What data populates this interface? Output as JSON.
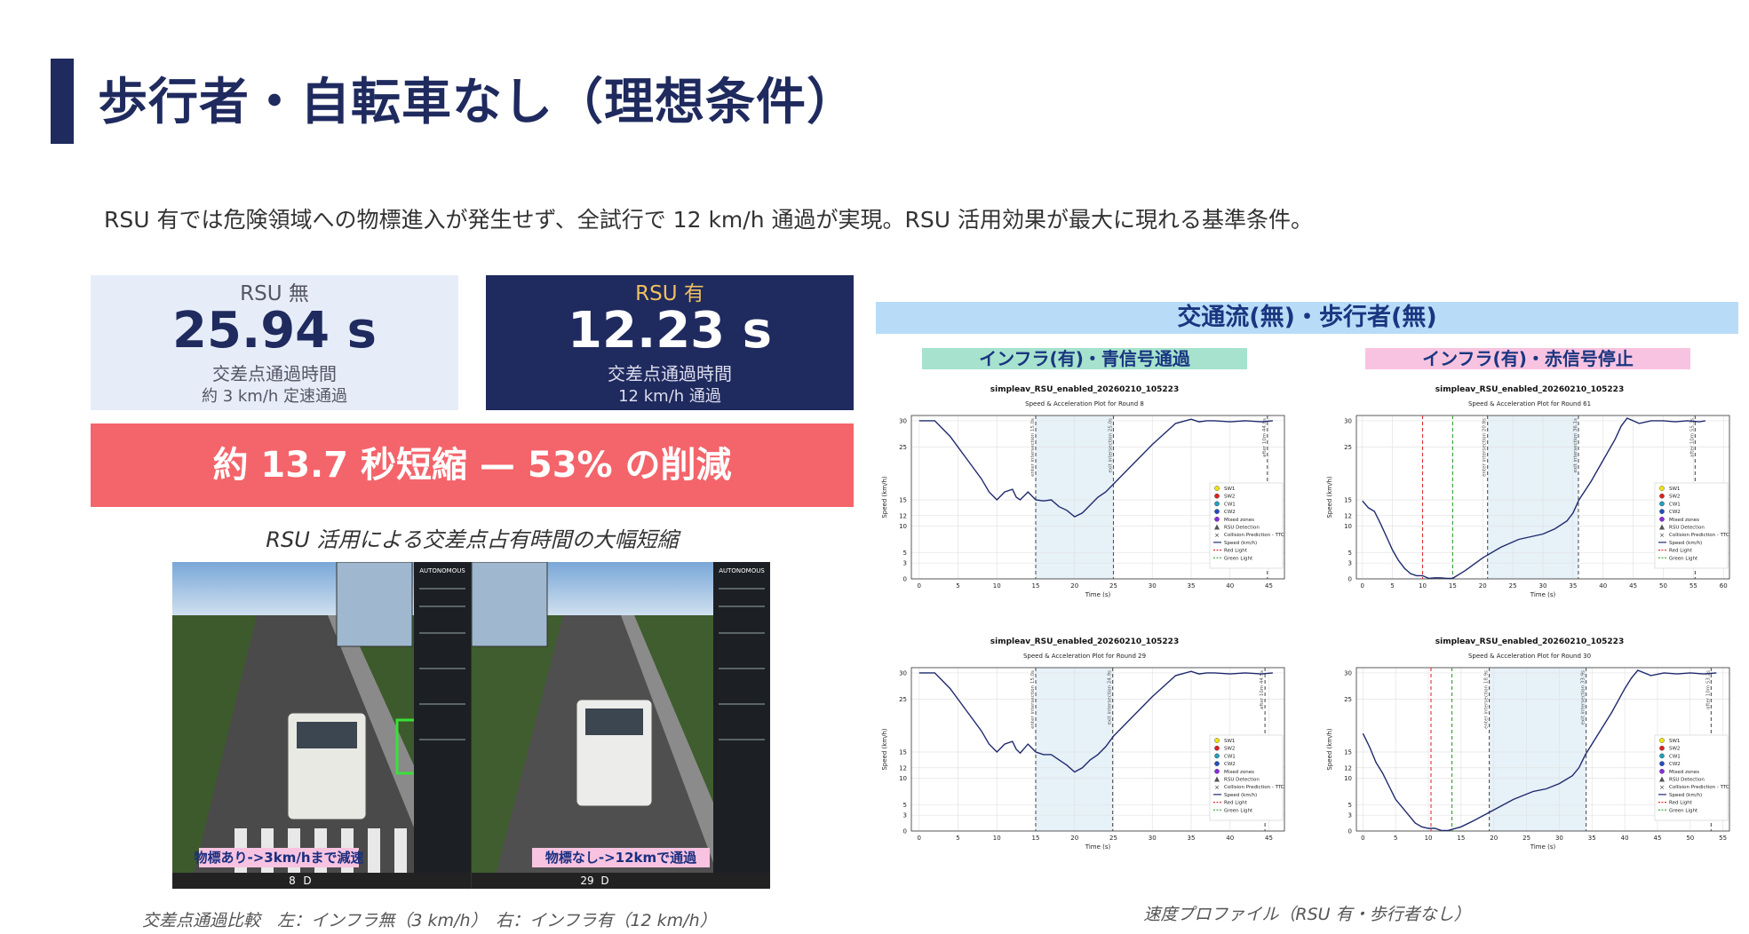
{
  "header": {
    "title": "歩行者・自転車なし（理想条件）",
    "subtitle": "RSU 有では危険領域への物標進入が発生せず、全試行で 12 km/h 通過が実現。RSU 活用効果が最大に現れる基準条件。"
  },
  "cards": {
    "off": {
      "label": "RSU 無",
      "value": "25.94 s",
      "desc": "交差点通過時間",
      "note": "約 3 km/h 定速通過"
    },
    "on": {
      "label": "RSU 有",
      "value": "12.23 s",
      "desc": "交差点通過時間",
      "note": "12 km/h 通過"
    }
  },
  "banner": "約 13.7 秒短縮 — 53% の削減",
  "comparison_caption": "RSU 活用による交差点占有時間の大幅短縮",
  "screenshot": {
    "left_overlay": "物標あり->3km/hまで減速",
    "right_overlay": "物標なし->12kmで通過",
    "panel_title": "AUTONOMOUS",
    "left_speed": "8",
    "left_gear": "D",
    "right_speed": "29",
    "right_gear": "D",
    "caption": "交差点通過比較　左：インフラ無（3 km/h）　右：インフラ有（12 km/h）"
  },
  "charts_header": "交通流(無)・歩行者(無)",
  "chart_col_labels": [
    "インフラ(有)・青信号通過",
    "インフラ(有)・赤信号停止"
  ],
  "profile_caption": "速度プロファイル（RSU 有・歩行者なし）",
  "legend_items": [
    "SW1",
    "SW2",
    "CW1",
    "CW2",
    "Mixed zones",
    "RSU Detection",
    "Collision Prediction - TTC",
    "Speed (km/h)",
    "Red Light",
    "Green Light"
  ],
  "legend_colors": [
    "#f2e600",
    "#e02020",
    "#20a0c0",
    "#2050c0",
    "#8a2be2",
    "#555555",
    "#333333",
    "#1f2a6e",
    "#e03030",
    "#30a030"
  ],
  "chart_data": [
    {
      "type": "line",
      "title": "simpleav_RSU_enabled_20260210_105223",
      "subtitle": "Speed & Acceleration Plot for Round 8",
      "xlabel": "Time (s)",
      "ylabel": "Speed (km/h)",
      "xlim": [
        -1,
        47
      ],
      "xticks": [
        0,
        5,
        10,
        15,
        20,
        25,
        30,
        35,
        40,
        45
      ],
      "ylim": [
        0,
        31
      ],
      "yticks": [
        0,
        3,
        5,
        10,
        12,
        15,
        25,
        30
      ],
      "grid": true,
      "legend": "right",
      "shade": [
        15,
        25
      ],
      "vlines": [
        {
          "x": 15,
          "color": "#555",
          "label": "enter intersection 15.0s"
        },
        {
          "x": 25,
          "color": "#555",
          "label": "exit intersection 25.0s"
        },
        {
          "x": 44.8,
          "color": "#555",
          "label": "after 10m 44.8s"
        }
      ],
      "series": [
        {
          "x": [
            0,
            2,
            4,
            6,
            8,
            9,
            10,
            11,
            12,
            12.5,
            13,
            14,
            15,
            16,
            17,
            18,
            19,
            20,
            21,
            22,
            23,
            24,
            25,
            27,
            30,
            33,
            35,
            36,
            37,
            38,
            40,
            42,
            44,
            45.5
          ],
          "y": [
            30,
            30,
            27,
            23,
            19,
            16.5,
            15,
            16.5,
            17,
            15.5,
            15,
            16.5,
            15,
            14.8,
            15,
            13.7,
            13,
            11.8,
            12.5,
            14,
            15.5,
            16.5,
            18,
            21,
            25.5,
            29.5,
            30.3,
            29.8,
            30,
            30,
            29.8,
            30,
            29.8,
            30
          ]
        }
      ]
    },
    {
      "type": "line",
      "title": "simpleav_RSU_enabled_20260210_105223",
      "subtitle": "Speed & Acceleration Plot for Round 61",
      "xlabel": "Time (s)",
      "ylabel": "Speed (km/h)",
      "xlim": [
        -1,
        61
      ],
      "xticks": [
        0,
        5,
        10,
        15,
        20,
        25,
        30,
        35,
        40,
        45,
        50,
        55,
        60
      ],
      "ylim": [
        0,
        31
      ],
      "yticks": [
        0,
        3,
        5,
        10,
        12,
        15,
        25,
        30
      ],
      "grid": true,
      "legend": "right",
      "shade": [
        20.8,
        35.9
      ],
      "vlines": [
        {
          "x": 10,
          "color": "#e03030",
          "label": ""
        },
        {
          "x": 15,
          "color": "#30a030",
          "label": ""
        },
        {
          "x": 20.8,
          "color": "#555",
          "label": "enter intersection 20.8s"
        },
        {
          "x": 35.9,
          "color": "#555",
          "label": "exit intersection 36.1s"
        },
        {
          "x": 55.3,
          "color": "#555",
          "label": "after 10m 55.3s"
        }
      ],
      "series": [
        {
          "x": [
            0,
            1,
            2,
            3,
            4,
            5,
            6,
            7,
            8,
            9,
            10,
            11,
            12,
            13,
            14,
            15,
            17,
            20,
            23,
            26,
            28,
            30,
            32,
            34,
            35,
            36,
            38,
            40,
            42,
            43,
            44,
            46,
            48,
            50,
            52,
            54,
            56,
            57
          ],
          "y": [
            14.8,
            13.5,
            12.8,
            10.5,
            8,
            5.5,
            3.5,
            2,
            1,
            0.6,
            0.6,
            0.1,
            0.2,
            0.2,
            0.1,
            0.1,
            1.5,
            4,
            6,
            7.5,
            8,
            8.5,
            9.5,
            11,
            12.5,
            15,
            18.5,
            22.5,
            26.5,
            29,
            30.5,
            29.5,
            30,
            30,
            29.8,
            30,
            29.8,
            30
          ]
        }
      ]
    },
    {
      "type": "line",
      "title": "simpleav_RSU_enabled_20260210_105223",
      "subtitle": "Speed & Acceleration Plot for Round 29",
      "xlabel": "Time (s)",
      "ylabel": "Speed (km/h)",
      "xlim": [
        -1,
        47
      ],
      "xticks": [
        0,
        5,
        10,
        15,
        20,
        25,
        30,
        35,
        40,
        45
      ],
      "ylim": [
        0,
        31
      ],
      "yticks": [
        0,
        3,
        5,
        10,
        12,
        15,
        25,
        30
      ],
      "grid": true,
      "legend": "right",
      "shade": [
        15,
        24.9
      ],
      "vlines": [
        {
          "x": 15,
          "color": "#555",
          "label": "enter intersection 15.0s"
        },
        {
          "x": 24.9,
          "color": "#555",
          "label": "exit intersection 24.9s"
        },
        {
          "x": 44.5,
          "color": "#555",
          "label": "after 10m 44.5s"
        }
      ],
      "series": [
        {
          "x": [
            0,
            2,
            4,
            6,
            8,
            9,
            10,
            11,
            12,
            12.5,
            13,
            14,
            15,
            16,
            17,
            18,
            19,
            20,
            21,
            22,
            23,
            24,
            25,
            27,
            30,
            33,
            35,
            36,
            37,
            38,
            40,
            42,
            44,
            45.5
          ],
          "y": [
            30,
            30,
            27,
            23,
            19,
            16.5,
            15,
            16.5,
            17,
            15.5,
            14.8,
            16.5,
            15,
            14.5,
            14.5,
            13.5,
            12.5,
            11.2,
            12,
            13.5,
            14.5,
            16,
            18,
            21,
            25.5,
            29.5,
            30.3,
            29.8,
            30,
            30,
            29.8,
            30,
            29.8,
            30
          ]
        }
      ]
    },
    {
      "type": "line",
      "title": "simpleav_RSU_enabled_20260210_105223",
      "subtitle": "Speed & Acceleration Plot for Round 30",
      "xlabel": "Time (s)",
      "ylabel": "Speed (km/h)",
      "xlim": [
        -1,
        56
      ],
      "xticks": [
        0,
        5,
        10,
        15,
        20,
        25,
        30,
        35,
        40,
        45,
        50,
        55
      ],
      "ylim": [
        0,
        31
      ],
      "yticks": [
        0,
        3,
        5,
        10,
        12,
        15,
        25,
        30
      ],
      "grid": true,
      "legend": "right",
      "shade": [
        19.3,
        34.1
      ],
      "vlines": [
        {
          "x": 10.4,
          "color": "#e03030",
          "label": ""
        },
        {
          "x": 13.6,
          "color": "#30a030",
          "label": ""
        },
        {
          "x": 19.3,
          "color": "#555",
          "label": "enter intersection 18.9s"
        },
        {
          "x": 34.1,
          "color": "#555",
          "label": "exit intersection 33.9s"
        },
        {
          "x": 53.2,
          "color": "#555",
          "label": "after 10m 53.2s"
        }
      ],
      "series": [
        {
          "x": [
            0,
            1,
            2,
            3,
            4,
            5,
            6,
            7,
            8,
            9,
            10,
            11,
            12,
            13,
            15,
            17,
            20,
            23,
            26,
            28,
            30,
            32,
            33,
            34,
            36,
            38,
            40,
            41,
            42,
            44,
            46,
            48,
            50,
            52,
            54
          ],
          "y": [
            18.5,
            16,
            13,
            11,
            8.5,
            6,
            4.5,
            3,
            1.5,
            0.8,
            0.5,
            0.5,
            0.1,
            0.1,
            0.8,
            2,
            4,
            6,
            7.5,
            8,
            9,
            10.5,
            12,
            14.5,
            18.5,
            22.5,
            27,
            29,
            30.5,
            29.5,
            30,
            29.8,
            30,
            29.8,
            30
          ]
        }
      ]
    }
  ]
}
